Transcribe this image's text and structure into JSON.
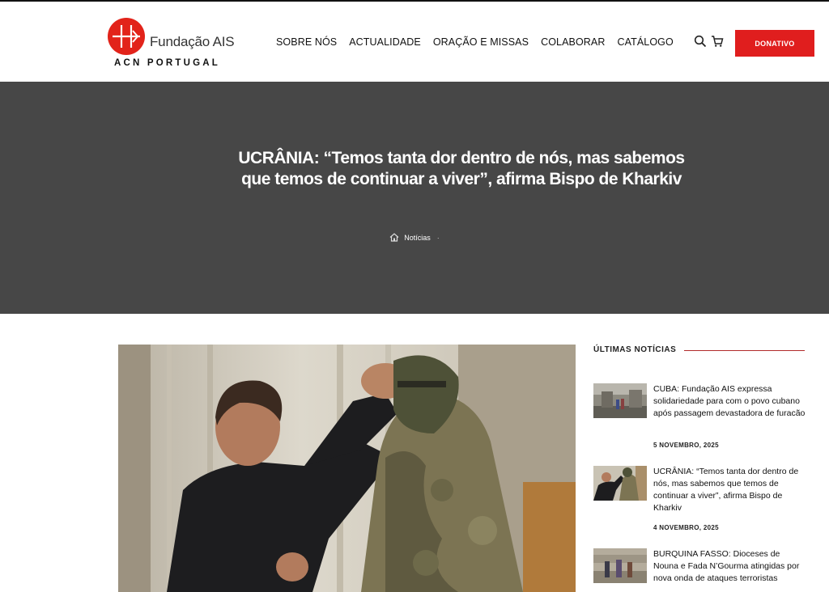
{
  "header": {
    "logo_name": "Fundação AIS",
    "logo_sub": "ACN PORTUGAL",
    "nav": [
      "SOBRE NÓS",
      "ACTUALIDADE",
      "ORAÇÃO E MISSAS",
      "COLABORAR",
      "CATÁLOGO"
    ],
    "donate_label": "DONATIVO",
    "icons": [
      "search-icon",
      "cart-icon"
    ],
    "brand_color": "#e01e1e"
  },
  "hero": {
    "title": "UCRÂNIA: “Temos tanta dor dentro de nós, mas sabemos que temos de continuar a viver”, afirma Bispo de Kharkiv",
    "breadcrumb": "Notícias",
    "background": "#474747"
  },
  "sidebar": {
    "heading": "ÚLTIMAS NOTÍCIAS",
    "items": [
      {
        "title": "CUBA: Fundação AIS expressa solidariedade para com o povo cubano após passagem devastadora de furacão",
        "date": "5 NOVEMBRO, 2025"
      },
      {
        "title": "UCRÂNIA: “Temos tanta dor dentro de nós, mas sabemos que temos de continuar a viver”, afirma Bispo de Kharkiv",
        "date": "4 NOVEMBRO, 2025"
      },
      {
        "title": "BURQUINA FASSO: Dioceses de Nouna e Fada N’Gourma atingidas por nova onda de ataques terroristas",
        "date": ""
      }
    ]
  }
}
